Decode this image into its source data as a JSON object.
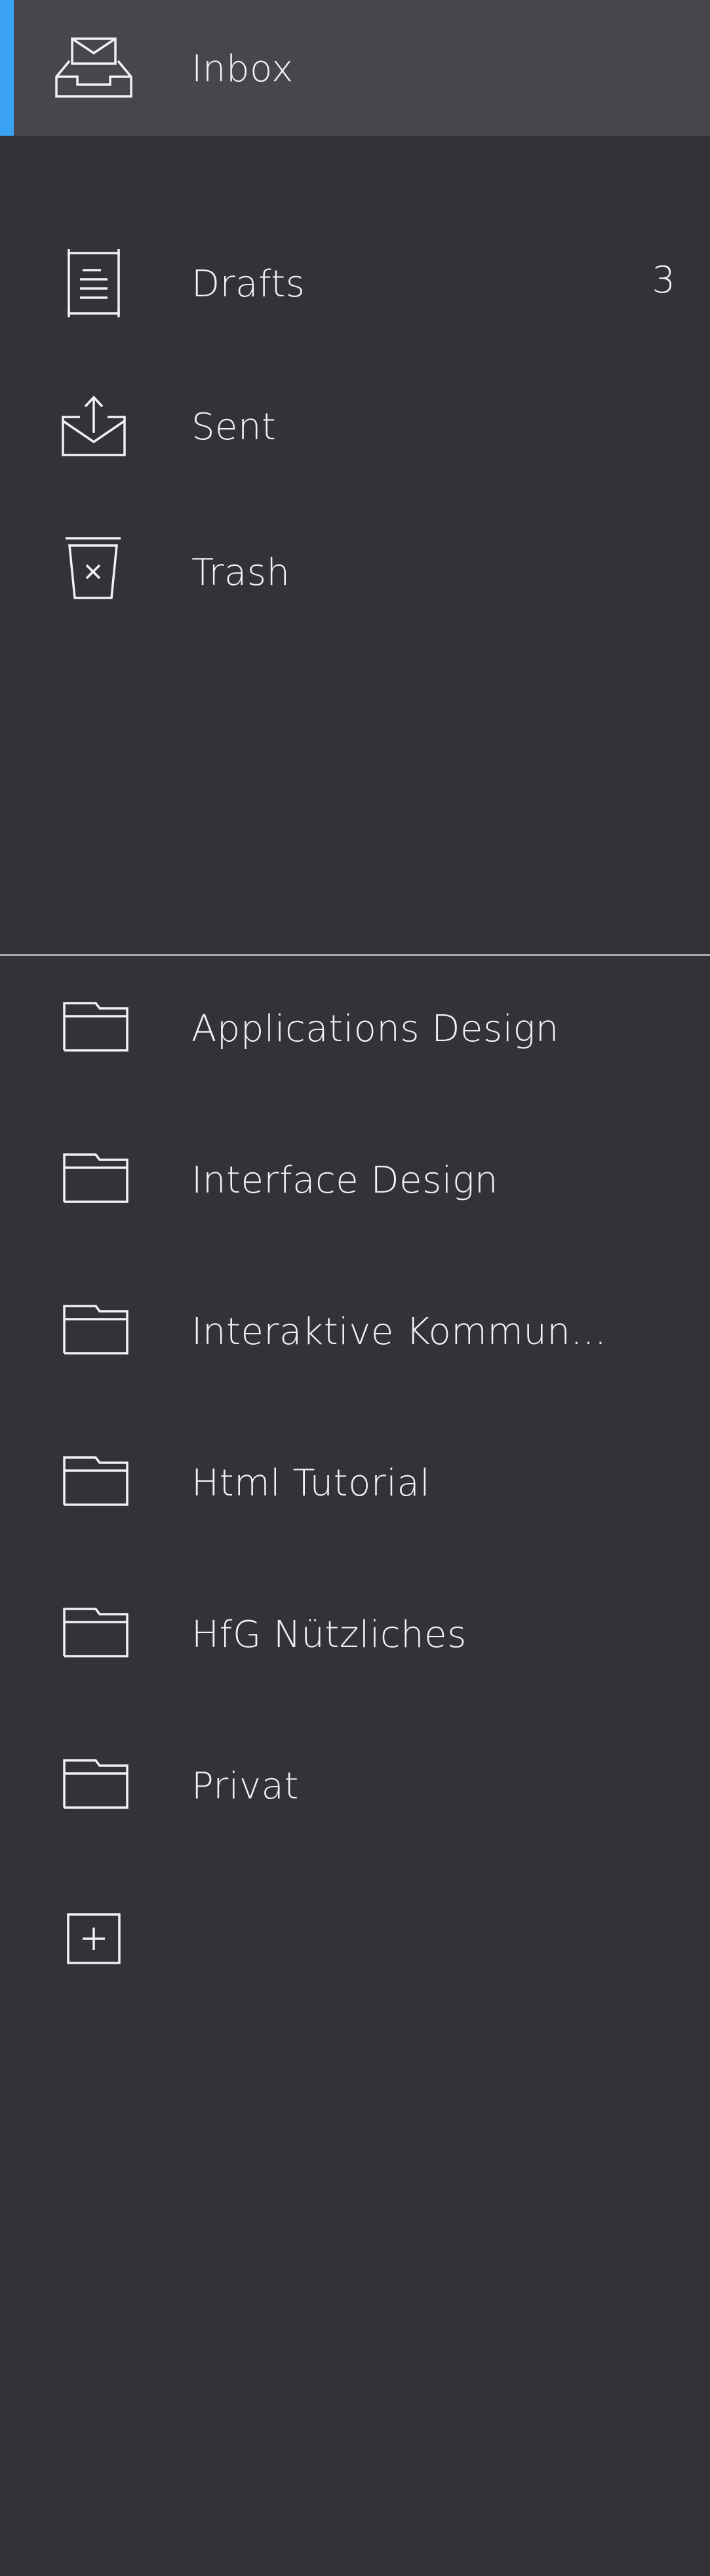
{
  "mailboxes": [
    {
      "id": "inbox",
      "label": "Inbox",
      "icon": "inbox-icon",
      "active": true
    },
    {
      "id": "drafts",
      "label": "Drafts",
      "icon": "drafts-icon",
      "count": "3"
    },
    {
      "id": "sent",
      "label": "Sent",
      "icon": "sent-icon"
    },
    {
      "id": "trash",
      "label": "Trash",
      "icon": "trash-icon"
    }
  ],
  "folders": [
    {
      "label": "Applications Design",
      "icon": "folder-icon"
    },
    {
      "label": "Interface Design",
      "icon": "folder-icon"
    },
    {
      "label": "Interaktive Kommun...",
      "icon": "folder-icon"
    },
    {
      "label": "Html Tutorial",
      "icon": "folder-icon"
    },
    {
      "label": "HfG Nützliches",
      "icon": "folder-icon"
    },
    {
      "label": "Privat",
      "icon": "folder-icon"
    }
  ],
  "add_folder": {
    "icon": "add-folder-icon"
  },
  "colors": {
    "background": "#333237",
    "active_row": "#47464b",
    "accent": "#3aa3f3",
    "text": "#f1f1f3",
    "divider": "#a9a8ad"
  }
}
